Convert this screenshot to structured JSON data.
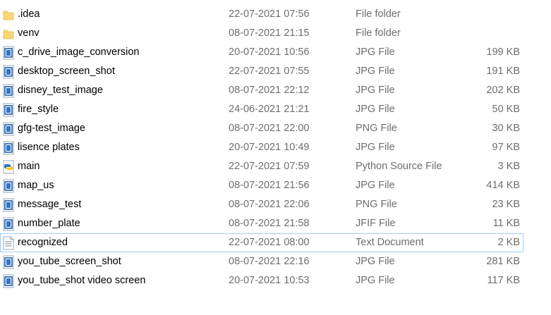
{
  "files": [
    {
      "name": ".idea",
      "date": "22-07-2021 07:56",
      "type": "File folder",
      "size": "",
      "icon": "folder-icon"
    },
    {
      "name": "venv",
      "date": "08-07-2021 21:15",
      "type": "File folder",
      "size": "",
      "icon": "folder-icon"
    },
    {
      "name": "c_drive_image_conversion",
      "date": "20-07-2021 10:56",
      "type": "JPG File",
      "size": "199 KB",
      "icon": "image-file-icon"
    },
    {
      "name": "desktop_screen_shot",
      "date": "22-07-2021 07:55",
      "type": "JPG File",
      "size": "191 KB",
      "icon": "image-file-icon"
    },
    {
      "name": "disney_test_image",
      "date": "08-07-2021 22:12",
      "type": "JPG File",
      "size": "202 KB",
      "icon": "image-file-icon"
    },
    {
      "name": "fire_style",
      "date": "24-06-2021 21:21",
      "type": "JPG File",
      "size": "50 KB",
      "icon": "image-file-icon"
    },
    {
      "name": "gfg-test_image",
      "date": "08-07-2021 22:00",
      "type": "PNG File",
      "size": "30 KB",
      "icon": "image-file-icon"
    },
    {
      "name": "lisence plates",
      "date": "20-07-2021 10:49",
      "type": "JPG File",
      "size": "97 KB",
      "icon": "image-file-icon"
    },
    {
      "name": "main",
      "date": "22-07-2021 07:59",
      "type": "Python Source File",
      "size": "3 KB",
      "icon": "python-file-icon"
    },
    {
      "name": "map_us",
      "date": "08-07-2021 21:56",
      "type": "JPG File",
      "size": "414 KB",
      "icon": "image-file-icon"
    },
    {
      "name": "message_test",
      "date": "08-07-2021 22:06",
      "type": "PNG File",
      "size": "23 KB",
      "icon": "image-file-icon"
    },
    {
      "name": "number_plate",
      "date": "08-07-2021 21:58",
      "type": "JFIF File",
      "size": "11 KB",
      "icon": "image-file-icon"
    },
    {
      "name": "recognized",
      "date": "22-07-2021 08:00",
      "type": "Text Document",
      "size": "2 KB",
      "icon": "text-file-icon",
      "focused": true
    },
    {
      "name": "you_tube_screen_shot",
      "date": "08-07-2021 22:16",
      "type": "JPG File",
      "size": "281 KB",
      "icon": "image-file-icon"
    },
    {
      "name": "you_tube_shot video screen",
      "date": "20-07-2021 10:53",
      "type": "JPG File",
      "size": "117 KB",
      "icon": "image-file-icon"
    }
  ],
  "colors": {
    "folder": "#f8d775",
    "image_frame": "#1e5fa8",
    "focus_border": "#99d1ff",
    "secondary_text": "#6d6d6d"
  }
}
